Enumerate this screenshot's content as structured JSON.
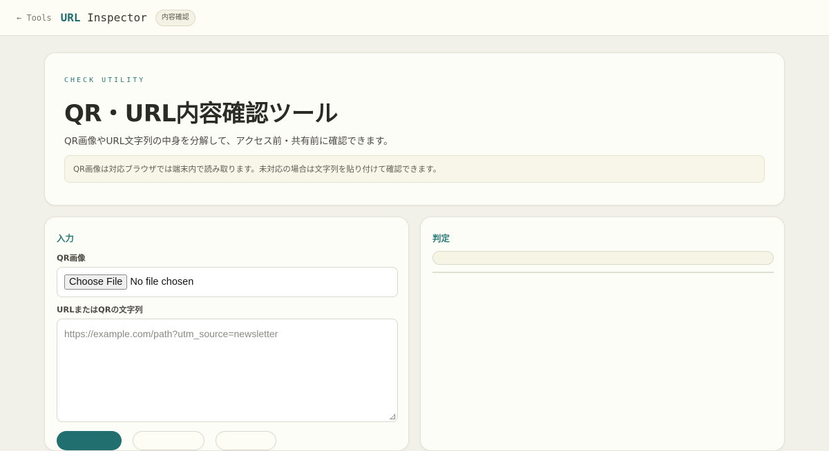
{
  "header": {
    "back_link": "← Tools",
    "title_accent": "URL",
    "title_rest": " Inspector",
    "badge": "内容確認"
  },
  "hero": {
    "eyebrow": "CHECK UTILITY",
    "title": "QR・URL内容確認ツール",
    "description": "QR画像やURL文字列の中身を分解して、アクセス前・共有前に確認できます。",
    "notice": "QR画像は対応ブラウザでは端末内で読み取ります。未対応の場合は文字列を貼り付けて確認できます。"
  },
  "input_panel": {
    "title": "入力",
    "qr_label": "QR画像",
    "file_button": "Choose File",
    "file_status": "No file chosen",
    "text_label": "URLまたはQRの文字列",
    "text_placeholder": "https://example.com/path?utm_source=newsletter"
  },
  "result_panel": {
    "title": "判定"
  },
  "colors": {
    "accent": "#216f70",
    "background": "#f1f1e9",
    "card": "#fdfdf7"
  }
}
